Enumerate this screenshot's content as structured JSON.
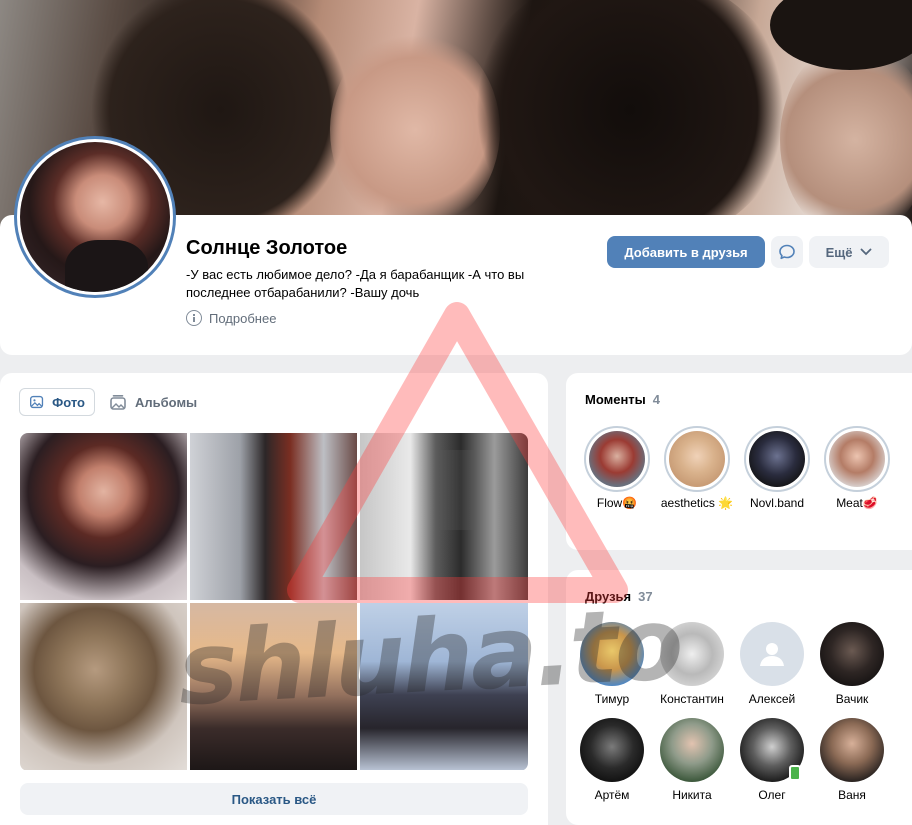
{
  "profile": {
    "name": "Солнце Золотое",
    "status": "-У вас есть любимое дело? -Да я барабанщик -А что вы последнее отбарабанили? -Вашу дочь",
    "more_info": "Подробнее",
    "add_friend": "Добавить в друзья",
    "more_menu": "Ещё"
  },
  "photos": {
    "tabs": [
      {
        "label": "Фото",
        "active": true
      },
      {
        "label": "Альбомы",
        "active": false
      }
    ],
    "show_all": "Показать всё"
  },
  "moments": {
    "title": "Моменты",
    "count": "4",
    "items": [
      {
        "label": "Flow🤬"
      },
      {
        "label": "aesthetics 🌟"
      },
      {
        "label": "Novl.band"
      },
      {
        "label": "Meat🥩"
      }
    ]
  },
  "friends": {
    "title": "Друзья",
    "count": "37",
    "items": [
      {
        "name": "Тимур"
      },
      {
        "name": "Константин"
      },
      {
        "name": "Алексей"
      },
      {
        "name": "Вачик"
      },
      {
        "name": "Артём"
      },
      {
        "name": "Никита"
      },
      {
        "name": "Олег"
      },
      {
        "name": "Ваня"
      }
    ]
  },
  "watermark": {
    "text": "shluha.to"
  },
  "colors": {
    "accent": "#5181b8",
    "link": "#2a5885",
    "muted": "#818c99",
    "background": "#edeef0"
  }
}
